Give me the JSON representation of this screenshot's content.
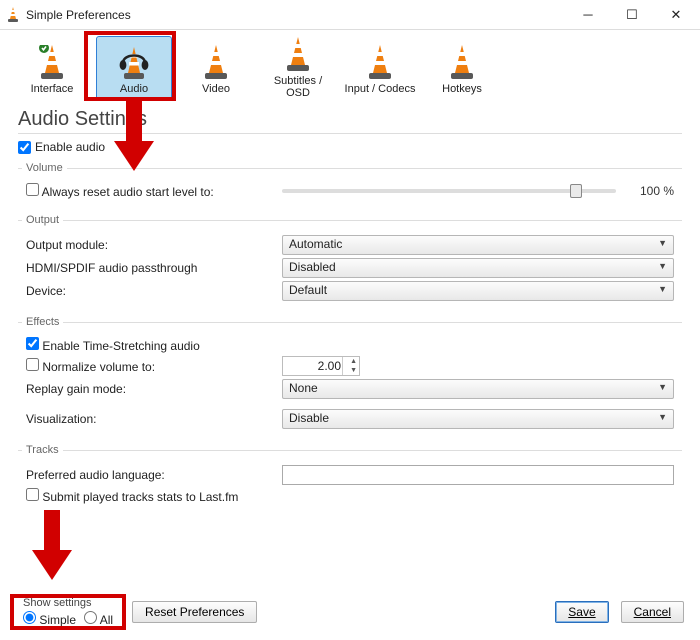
{
  "window": {
    "title": "Simple Preferences"
  },
  "tabs": [
    {
      "id": "interface",
      "label": "Interface"
    },
    {
      "id": "audio",
      "label": "Audio",
      "active": true
    },
    {
      "id": "video",
      "label": "Video"
    },
    {
      "id": "subs",
      "label": "Subtitles / OSD"
    },
    {
      "id": "input",
      "label": "Input / Codecs"
    },
    {
      "id": "hotkeys",
      "label": "Hotkeys"
    }
  ],
  "page": {
    "heading": "Audio Settings",
    "enable_audio": {
      "label": "Enable audio",
      "checked": true
    },
    "groups": {
      "volume": {
        "legend": "Volume",
        "reset_level": {
          "label": "Always reset audio start level to:",
          "checked": false,
          "percent": "100 %"
        }
      },
      "output": {
        "legend": "Output",
        "module": {
          "label": "Output module:",
          "value": "Automatic"
        },
        "passthrough": {
          "label": "HDMI/SPDIF audio passthrough",
          "value": "Disabled"
        },
        "device": {
          "label": "Device:",
          "value": "Default"
        }
      },
      "effects": {
        "legend": "Effects",
        "timestretch": {
          "label": "Enable Time-Stretching audio",
          "checked": true
        },
        "normalize": {
          "label": "Normalize volume to:",
          "checked": false,
          "value": "2.00"
        },
        "replay_gain": {
          "label": "Replay gain mode:",
          "value": "None"
        },
        "visualization": {
          "label": "Visualization:",
          "value": "Disable"
        }
      },
      "tracks": {
        "legend": "Tracks",
        "pref_lang": {
          "label": "Preferred audio language:",
          "value": ""
        },
        "lastfm": {
          "label": "Submit played tracks stats to Last.fm",
          "checked": false
        }
      }
    }
  },
  "footer": {
    "show_settings": {
      "label": "Show settings",
      "options": {
        "simple": "Simple",
        "all": "All"
      },
      "selected": "simple"
    },
    "reset": "Reset Preferences",
    "save": "Save",
    "cancel": "Cancel"
  },
  "annotations": {
    "audio_tab_box": true,
    "arrow_down_from_tab": true,
    "arrow_down_to_footer": true,
    "show_settings_box": true
  }
}
